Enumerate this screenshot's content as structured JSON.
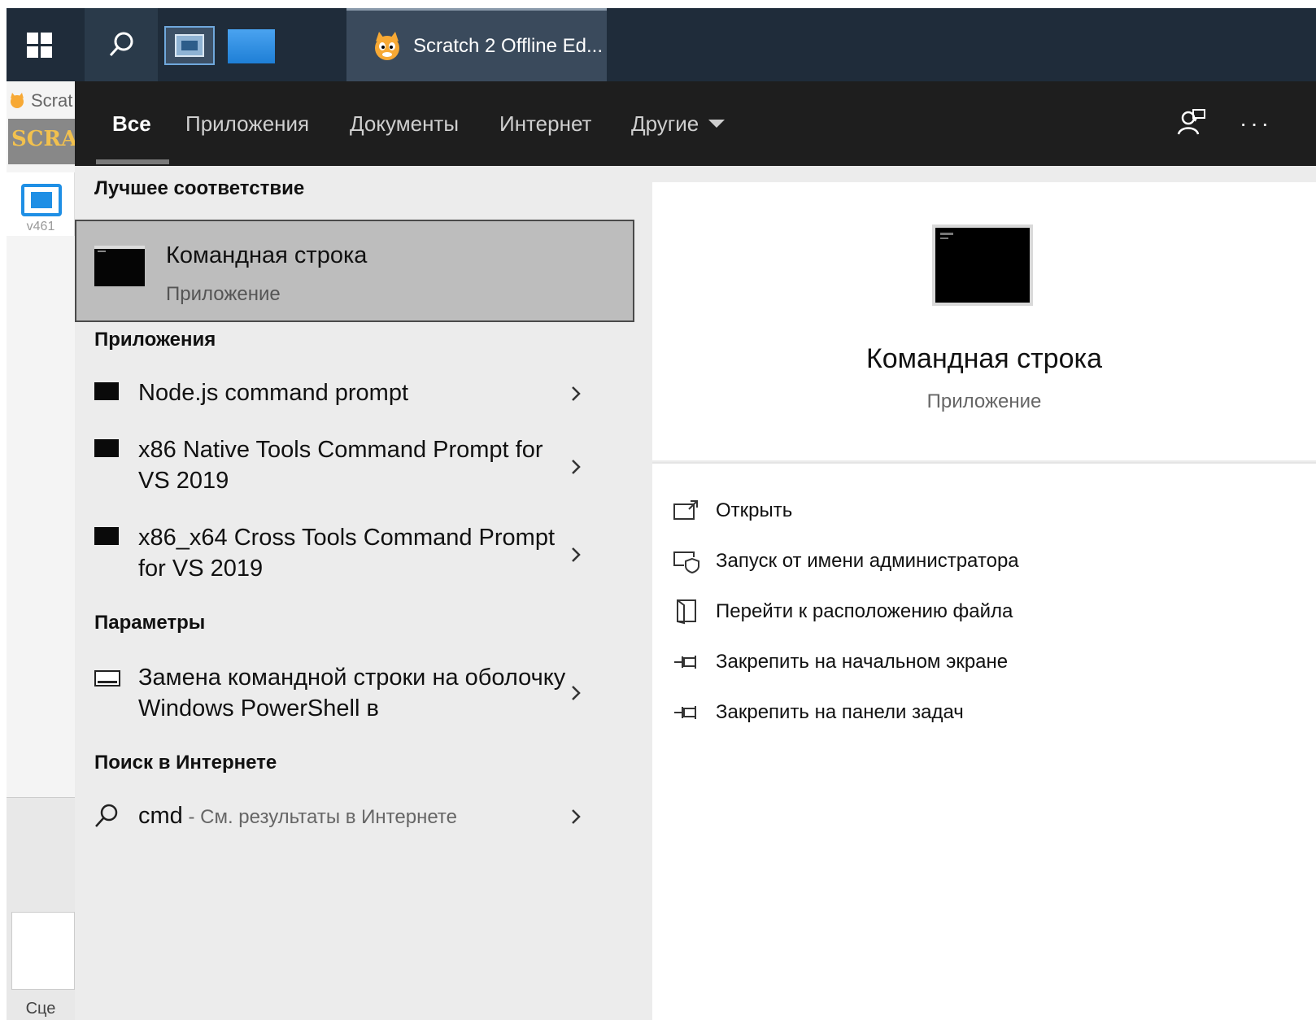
{
  "taskbar": {
    "app_label": "Scratch 2 Offline Ed..."
  },
  "background_app": {
    "title": "Scrat",
    "logo_text": "SCRATCH",
    "version": "v461",
    "panel_label": "Сце"
  },
  "search": {
    "tabs": [
      {
        "label": "Все",
        "active": true
      },
      {
        "label": "Приложения",
        "active": false
      },
      {
        "label": "Документы",
        "active": false
      },
      {
        "label": "Интернет",
        "active": false
      },
      {
        "label": "Другие",
        "active": false
      }
    ],
    "more_label": "···"
  },
  "results": {
    "best_match_title": "Лучшее соответствие",
    "best_match": {
      "name": "Командная строка",
      "type": "Приложение"
    },
    "apps_title": "Приложения",
    "apps": [
      {
        "label": "Node.js command prompt"
      },
      {
        "label": "x86 Native Tools Command Prompt for VS 2019"
      },
      {
        "label": "x86_x64 Cross Tools Command Prompt for VS 2019"
      }
    ],
    "settings_title": "Параметры",
    "settings": [
      {
        "label": "Замена командной строки на оболочку Windows PowerShell в"
      }
    ],
    "web_title": "Поиск в Интернете",
    "web": {
      "query": "cmd",
      "suffix": " - См. результаты в Интернете"
    }
  },
  "preview": {
    "name": "Командная строка",
    "type": "Приложение",
    "actions": [
      {
        "label": "Открыть",
        "icon": "open-icon"
      },
      {
        "label": "Запуск от имени администратора",
        "icon": "run-as-admin-icon"
      },
      {
        "label": "Перейти к расположению файла",
        "icon": "file-location-icon"
      },
      {
        "label": "Закрепить на начальном экране",
        "icon": "pin-start-icon"
      },
      {
        "label": "Закрепить на панели задач",
        "icon": "pin-taskbar-icon"
      }
    ]
  }
}
